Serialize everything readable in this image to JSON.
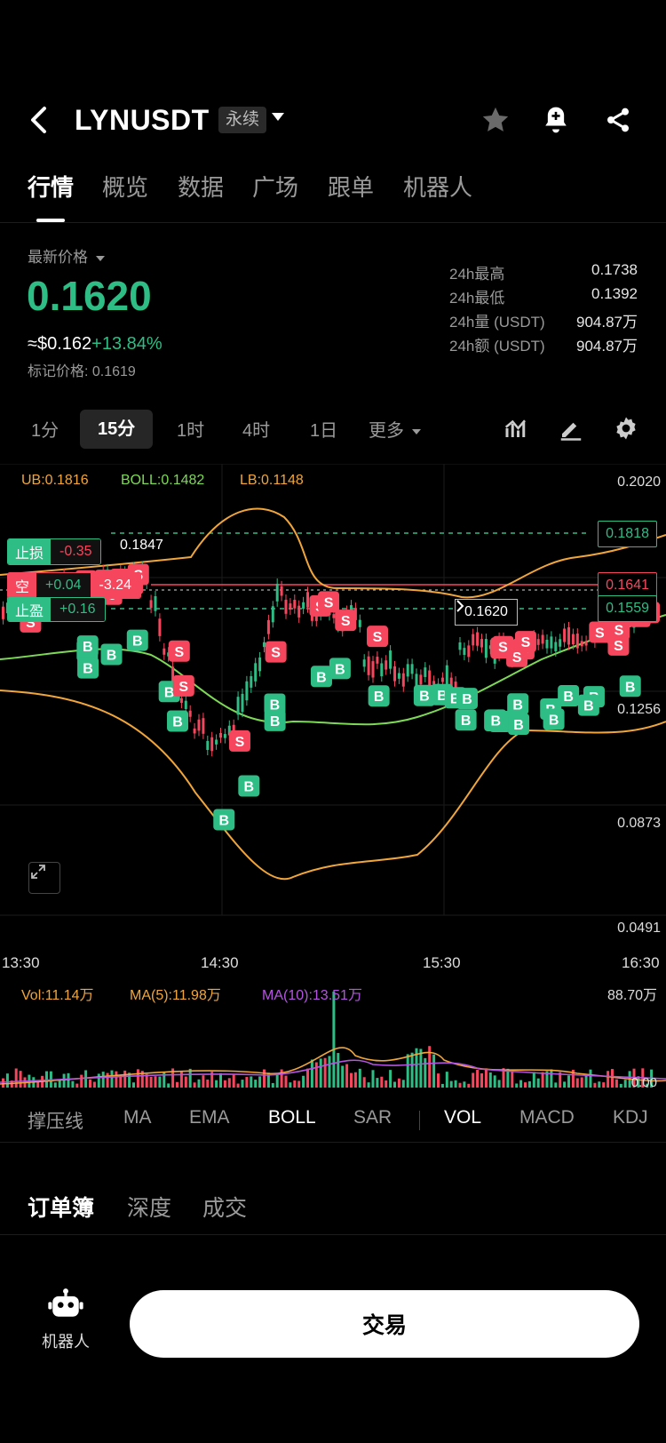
{
  "header": {
    "symbol": "LYNUSDT",
    "contract_type": "永续"
  },
  "tabs": [
    "行情",
    "概览",
    "数据",
    "广场",
    "跟单",
    "机器人"
  ],
  "price": {
    "latest_label": "最新价格",
    "last": "0.1620",
    "usd_approx": "≈$0.162",
    "change": "+13.84%",
    "mark_label": "标记价格: 0.1619",
    "stats": [
      {
        "label": "24h最高",
        "value": "0.1738"
      },
      {
        "label": "24h最低",
        "value": "0.1392"
      },
      {
        "label": "24h量 (USDT)",
        "value": "904.87万"
      },
      {
        "label": "24h额 (USDT)",
        "value": "904.87万"
      }
    ]
  },
  "intervals": [
    "1分",
    "15分",
    "1时",
    "4时",
    "1日",
    "更多"
  ],
  "indicators": {
    "ub": "UB:0.1816",
    "boll": "BOLL:0.1482",
    "lb": "LB:0.1148"
  },
  "chart": {
    "y_labels": [
      "0.2020",
      "0.1256",
      "0.0873",
      "0.0491"
    ],
    "x_labels": [
      "13:30",
      "14:30",
      "15:30",
      "16:30"
    ],
    "high_marker": "0.1847",
    "current_price": "0.1620",
    "stop_loss": {
      "label": "止损",
      "value": "-0.35",
      "price": "0.1818"
    },
    "short": {
      "label": "空",
      "value": "+0.04",
      "pnl": "-3.24",
      "price": "0.1641"
    },
    "take_profit": {
      "label": "止盈",
      "value": "+0.16",
      "price": "0.1559"
    },
    "colors": {
      "up": "#2ebd85",
      "down": "#f6465d",
      "ub": "#f0a63a",
      "boll": "#7ed957",
      "lb": "#f0a63a"
    }
  },
  "volume": {
    "vol": "Vol:11.14万",
    "ma5": "MA(5):11.98万",
    "ma10": "MA(10):13.51万",
    "max": "88.70万",
    "min": "0.00"
  },
  "indicator_tabs": [
    "撑压线",
    "MA",
    "EMA",
    "BOLL",
    "SAR",
    "VOL",
    "MACD",
    "KDJ"
  ],
  "book_tabs": [
    "订单簿",
    "深度",
    "成交"
  ],
  "bottom": {
    "robot_label": "机器人",
    "trade_label": "交易"
  }
}
